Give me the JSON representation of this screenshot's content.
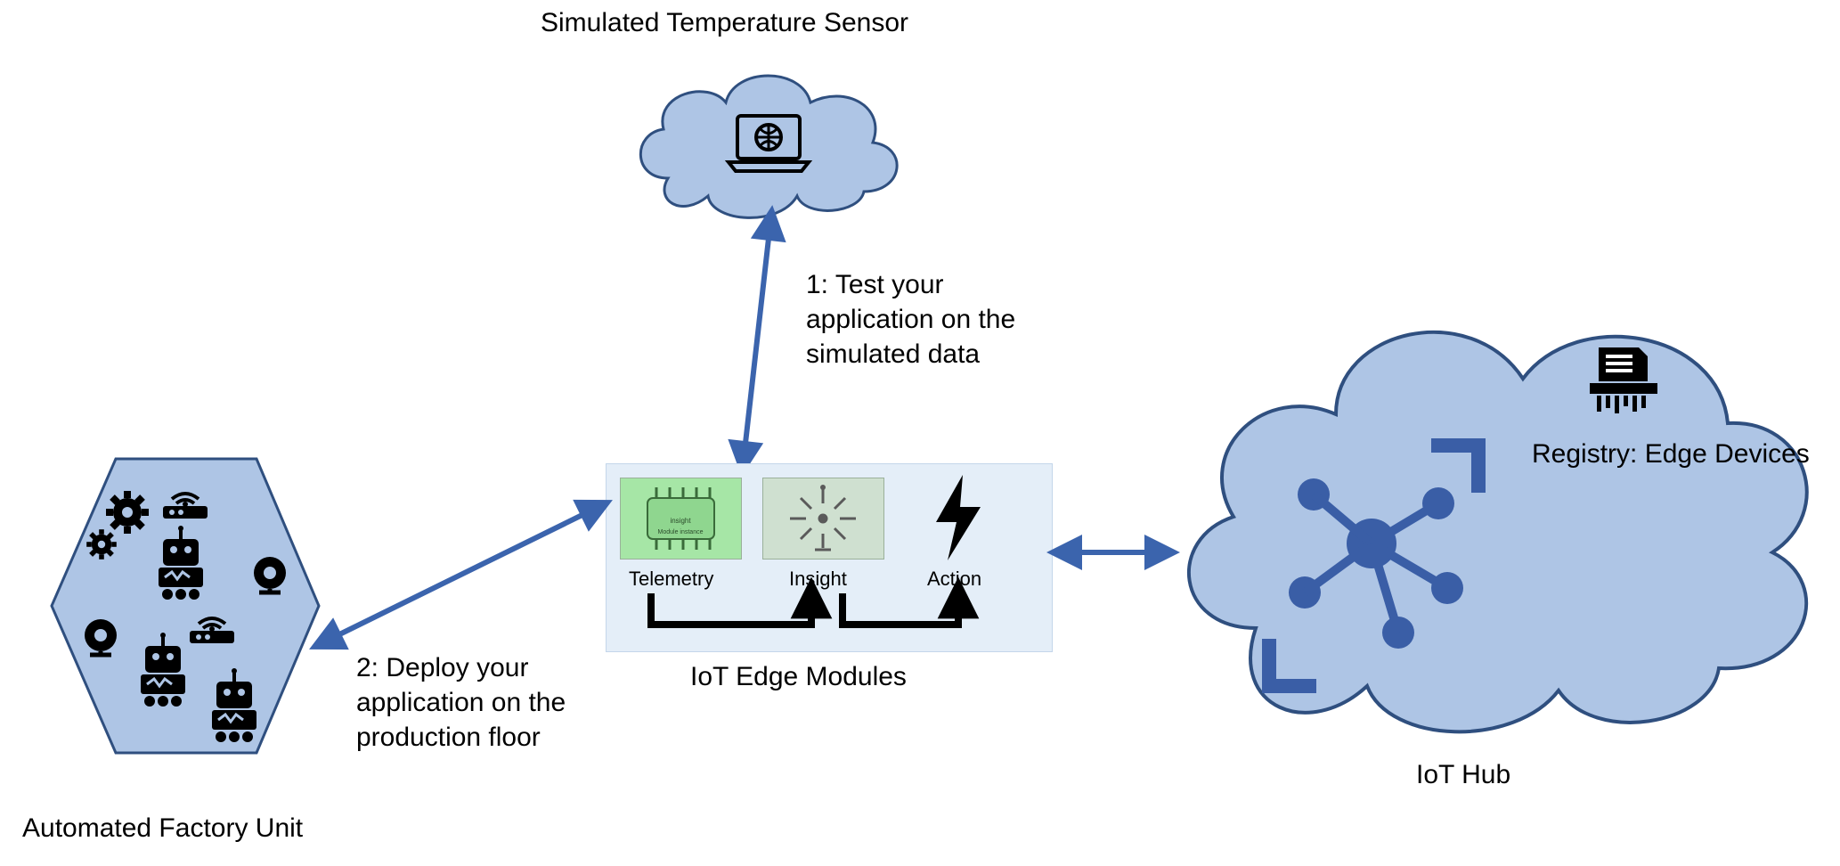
{
  "titles": {
    "simSensor": "Simulated Temperature Sensor",
    "factory": "Automated Factory Unit",
    "iotHub": "IoT Hub",
    "edgeModules": "IoT Edge Modules",
    "registry": "Registry: Edge Devices"
  },
  "modules": {
    "telemetry": "Telemetry",
    "insight": "Insight",
    "action": "Action"
  },
  "steps": {
    "step1": "1: Test your application on the simulated data",
    "step2": "2: Deploy your application on the production floor"
  }
}
